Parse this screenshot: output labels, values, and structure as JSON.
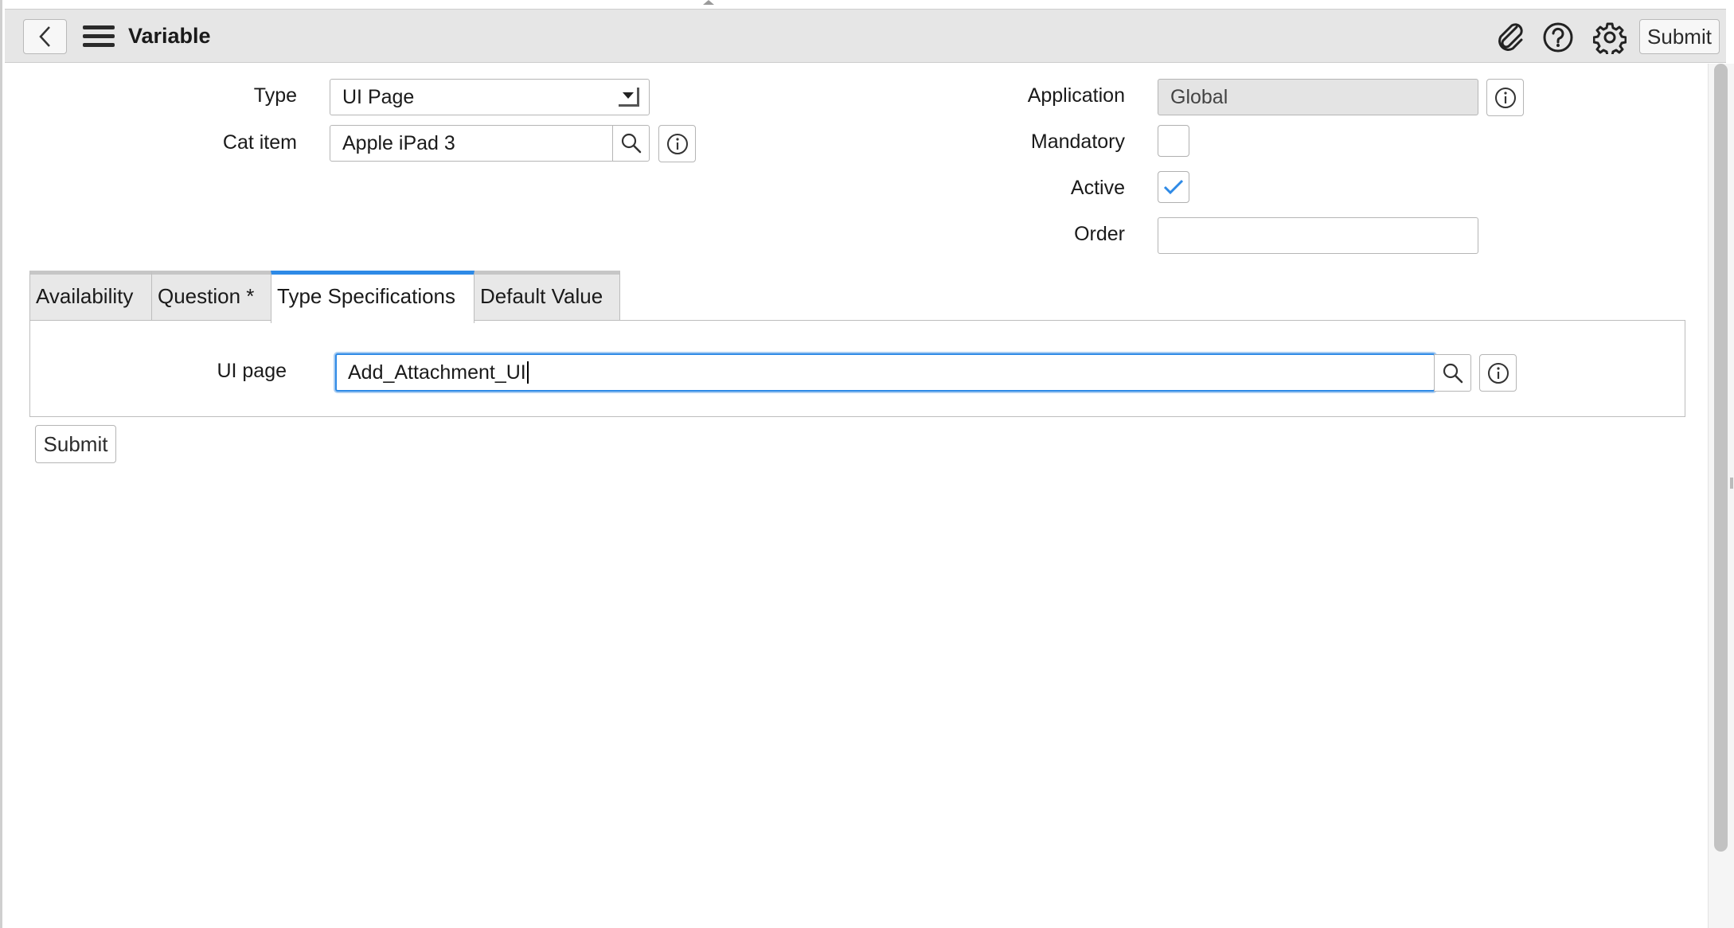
{
  "header": {
    "title": "Variable",
    "submit_label": "Submit"
  },
  "form": {
    "type": {
      "label": "Type",
      "value": "UI Page"
    },
    "cat_item": {
      "label": "Cat item",
      "value": "Apple iPad 3"
    },
    "application": {
      "label": "Application",
      "value": "Global"
    },
    "mandatory": {
      "label": "Mandatory",
      "checked": false
    },
    "active": {
      "label": "Active",
      "checked": true
    },
    "order": {
      "label": "Order",
      "value": ""
    }
  },
  "tabs": [
    {
      "label": "Availability"
    },
    {
      "label": "Question *"
    },
    {
      "label": "Type Specifications"
    },
    {
      "label": "Default Value"
    }
  ],
  "active_tab": "Type Specifications",
  "type_specifications": {
    "ui_page": {
      "label": "UI page",
      "value": "Add_Attachment_UI"
    }
  },
  "footer": {
    "submit_label": "Submit"
  },
  "colors": {
    "accent": "#2e8ae6",
    "header_bg": "#e6e6e6",
    "readonly_bg": "#e4e4e4"
  },
  "icons": [
    "back-chevron-icon",
    "hamburger-menu-icon",
    "paperclip-icon",
    "help-icon",
    "gear-icon",
    "search-icon",
    "info-icon",
    "checkmark-icon"
  ]
}
